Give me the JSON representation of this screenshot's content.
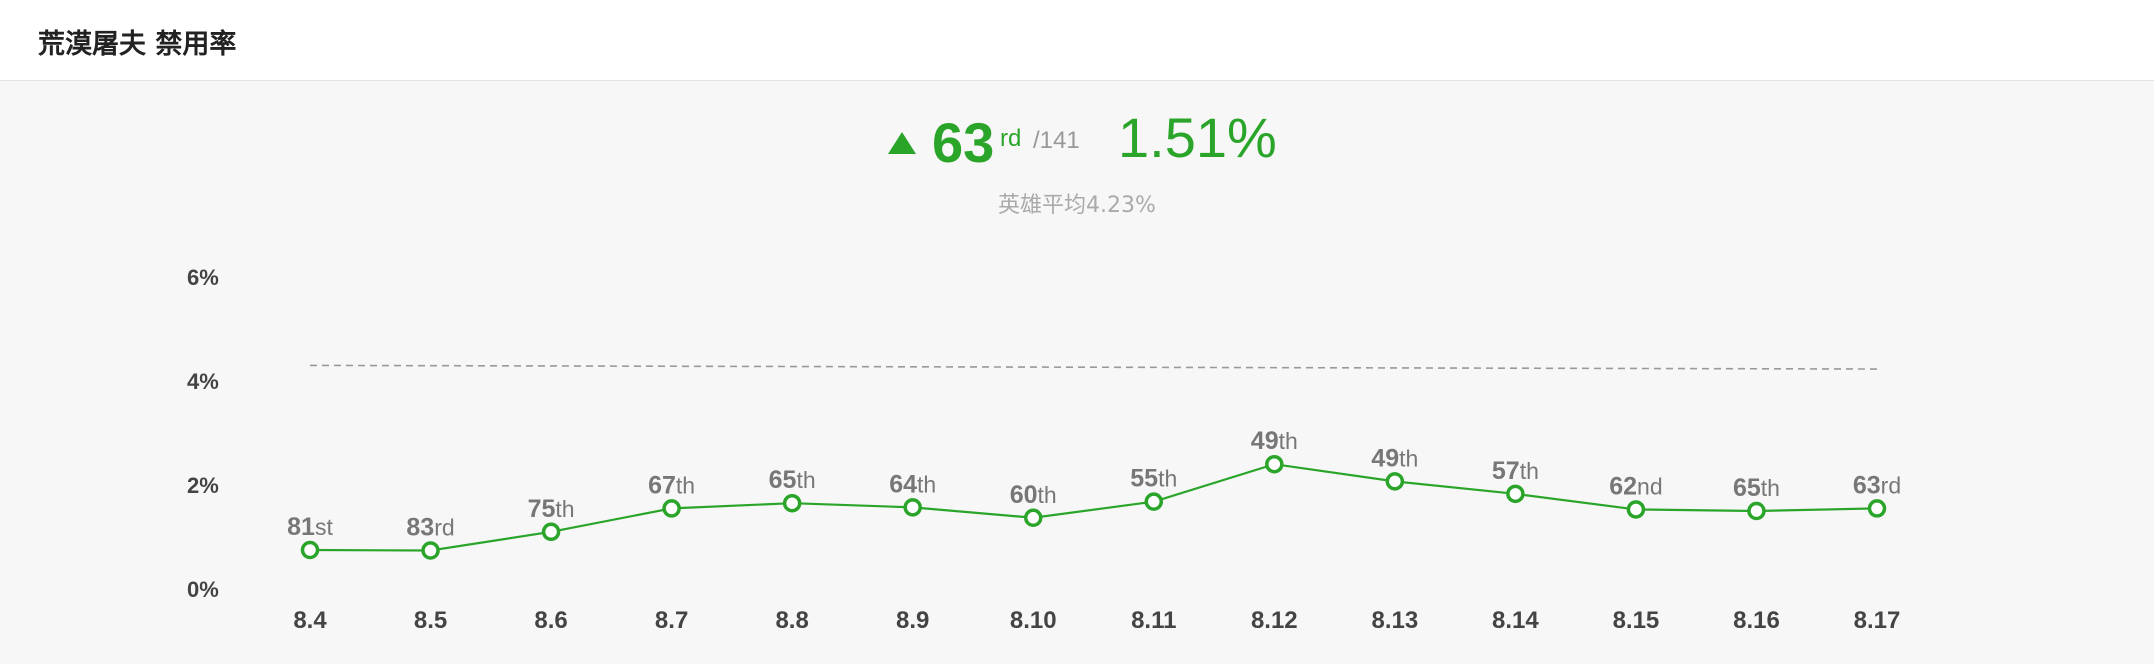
{
  "header": {
    "title": "荒漠屠夫 禁用率"
  },
  "summary": {
    "rank_number": "63",
    "rank_suffix": "rd",
    "rank_total": "/141",
    "rate": "1.51%",
    "average_text": "英雄平均4.23%",
    "trend": "up",
    "trend_icon": "triangle-up-icon"
  },
  "colors": {
    "accent": "#2aa52a",
    "average_line": "#999999",
    "axis_text": "#444444",
    "point_label": "#777777"
  },
  "chart_data": {
    "type": "line",
    "title": "",
    "xlabel": "",
    "ylabel": "",
    "ylim": [
      0,
      6
    ],
    "yticks": [
      "0%",
      "2%",
      "4%",
      "6%"
    ],
    "grid": false,
    "categories": [
      "8.4",
      "8.5",
      "8.6",
      "8.7",
      "8.8",
      "8.9",
      "8.10",
      "8.11",
      "8.12",
      "8.13",
      "8.14",
      "8.15",
      "8.16",
      "8.17"
    ],
    "series": [
      {
        "values": [
          0.75,
          0.74,
          1.1,
          1.55,
          1.65,
          1.57,
          1.37,
          1.68,
          2.4,
          2.07,
          1.83,
          1.53,
          1.5,
          1.55
        ],
        "ranks": [
          "81",
          "83",
          "75",
          "67",
          "65",
          "64",
          "60",
          "55",
          "49",
          "49",
          "57",
          "62",
          "65",
          "63"
        ],
        "rank_suffixes": [
          "st",
          "rd",
          "th",
          "th",
          "th",
          "th",
          "th",
          "th",
          "th",
          "th",
          "th",
          "nd",
          "th",
          "rd"
        ]
      }
    ],
    "average_line": {
      "start": 4.3,
      "end": 4.23,
      "style": "dashed"
    }
  }
}
